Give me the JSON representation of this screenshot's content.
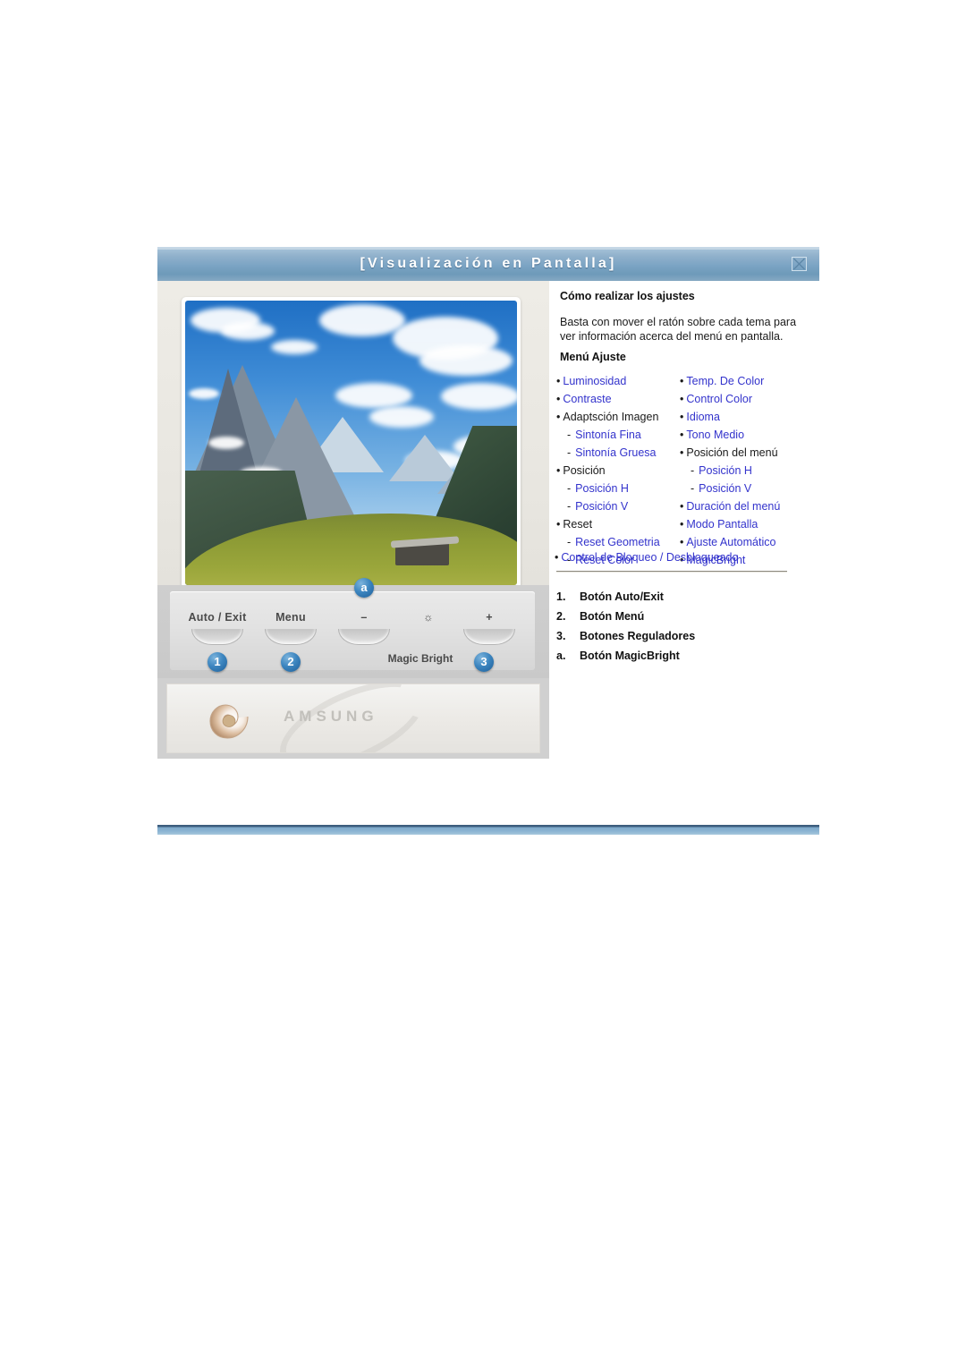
{
  "window": {
    "title": "[Visualización  en  Pantalla]",
    "close_icon": "close-icon"
  },
  "monitor": {
    "screen_image_alt": "alpine-mountain-landscape",
    "controls": [
      {
        "label": "Auto / Exit",
        "badge": "1"
      },
      {
        "label": "Menu",
        "badge": "2"
      },
      {
        "label": "–",
        "badge": "a"
      },
      {
        "label": "☼",
        "badge": ""
      },
      {
        "label": "+",
        "badge": "3"
      }
    ],
    "magic_bright_label": "Magic Bright",
    "brand_logo": "AMSUNG"
  },
  "doc": {
    "heading": "Cómo realizar los ajustes",
    "intro": "Basta con mover el ratón sobre cada tema para ver información acerca del menú en pantalla.",
    "menu_heading": "Menú Ajuste",
    "menu_left": [
      {
        "marker": "•",
        "label": "Luminosidad",
        "level": 1,
        "link": true
      },
      {
        "marker": "•",
        "label": "Contraste",
        "level": 1,
        "link": true
      },
      {
        "marker": "•",
        "label": "Adaptsción Imagen",
        "level": 1,
        "link": false
      },
      {
        "marker": "-",
        "label": "Sintonía Fina",
        "level": 2,
        "link": true
      },
      {
        "marker": "-",
        "label": "Sintonía Gruesa",
        "level": 2,
        "link": true
      },
      {
        "marker": "•",
        "label": "Posición",
        "level": 1,
        "link": false
      },
      {
        "marker": "-",
        "label": "Posición H",
        "level": 2,
        "link": true
      },
      {
        "marker": "-",
        "label": "Posición V",
        "level": 2,
        "link": true
      },
      {
        "marker": "•",
        "label": "Reset",
        "level": 1,
        "link": false
      },
      {
        "marker": "-",
        "label": "Reset Geometria",
        "level": 2,
        "link": true
      },
      {
        "marker": "-",
        "label": "Reset Color",
        "level": 2,
        "link": true
      }
    ],
    "menu_right": [
      {
        "marker": "•",
        "label": "Temp. De Color",
        "level": 1,
        "link": true
      },
      {
        "marker": "•",
        "label": "Control Color",
        "level": 1,
        "link": true
      },
      {
        "marker": "•",
        "label": "Idioma",
        "level": 1,
        "link": true
      },
      {
        "marker": "•",
        "label": "Tono Medio",
        "level": 1,
        "link": true
      },
      {
        "marker": "•",
        "label": "Posición del menú",
        "level": 1,
        "link": false
      },
      {
        "marker": "-",
        "label": "Posición H",
        "level": 2,
        "link": true
      },
      {
        "marker": "-",
        "label": "Posición V",
        "level": 2,
        "link": true
      },
      {
        "marker": "•",
        "label": "Duración del menú",
        "level": 1,
        "link": true
      },
      {
        "marker": "•",
        "label": "Modo Pantalla",
        "level": 1,
        "link": true
      },
      {
        "marker": "•",
        "label": "Ajuste Automático",
        "level": 1,
        "link": true
      },
      {
        "marker": "•",
        "label": "MagicBright",
        "level": 1,
        "link": true
      }
    ],
    "menu_footer": {
      "marker": "•",
      "label": "Control de Bloqueo / Desbloqueado",
      "link": true
    },
    "numbered_list": [
      {
        "num": "1.",
        "label": "Botón Auto/Exit"
      },
      {
        "num": "2.",
        "label": "Botón Menú"
      },
      {
        "num": "3.",
        "label": "Botones Reguladores"
      },
      {
        "num": "a.",
        "label": "Botón MagicBright"
      }
    ]
  },
  "colors": {
    "titlebar_blue": "#7ba4c4",
    "link_blue": "#3333cc",
    "badge_blue": "#3d86c0",
    "rule_dark": "#3c5d7d"
  }
}
